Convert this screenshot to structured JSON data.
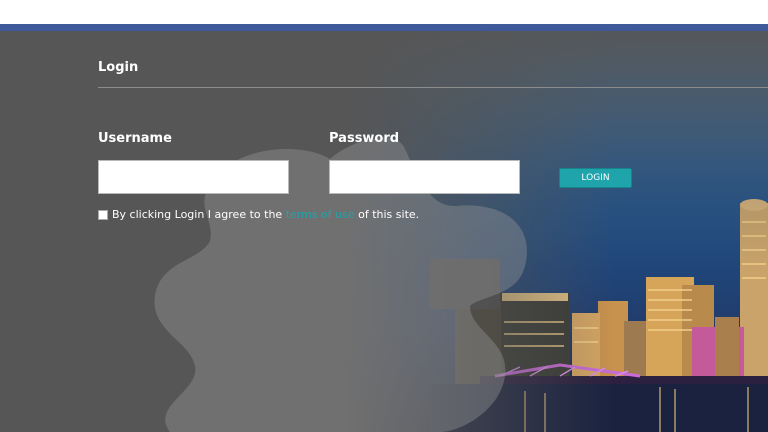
{
  "login": {
    "section_title": "Login",
    "username_label": "Username",
    "password_label": "Password",
    "username_value": "",
    "password_value": "",
    "login_button": "LOGIN",
    "agree_prefix": "By clicking Login I agree to the",
    "terms_link": "terms of use",
    "agree_suffix": "of this site.",
    "checkbox_checked": false
  },
  "colors": {
    "accent_bar": "#3e5a9a",
    "panel_bg": "#565656",
    "button_bg": "#1fa4ac",
    "link": "#23a3a9"
  },
  "icons": {
    "background_shape": "puzzle-piece-watermark",
    "background_image": "city-skyline-night"
  }
}
